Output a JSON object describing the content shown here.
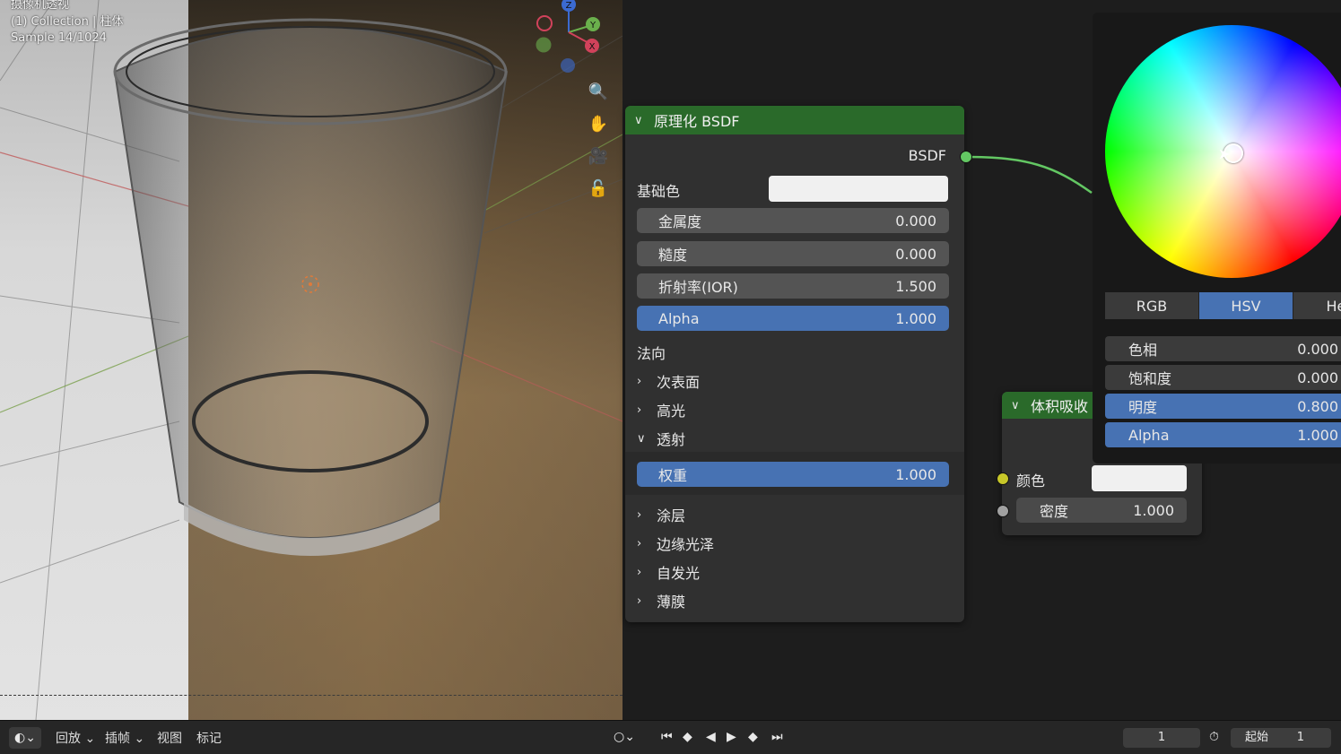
{
  "viewport": {
    "mode_label": "摄像机透视",
    "collection_label": "(1) Collection | 柱体",
    "sample_label": "Sample 14/1024",
    "gizmo_axes": {
      "z": "Z",
      "y": "Y",
      "x": "X"
    },
    "nav_icons": [
      "zoom-icon",
      "hand-icon",
      "camera-icon",
      "lock-icon"
    ]
  },
  "bsdf_node": {
    "title": "原理化 BSDF",
    "output_label": "BSDF",
    "base_color_label": "基础色",
    "fields": [
      {
        "label": "金属度",
        "value": "0.000"
      },
      {
        "label": "糙度",
        "value": "0.000"
      },
      {
        "label": "折射率(IOR)",
        "value": "1.500"
      },
      {
        "label": "Alpha",
        "value": "1.000"
      }
    ],
    "normal_label": "法向",
    "sections": [
      "次表面",
      "高光",
      "透射"
    ],
    "transmission_weight": {
      "label": "权重",
      "value": "1.000"
    },
    "sections_after": [
      "涂层",
      "边缘光泽",
      "自发光",
      "薄膜"
    ]
  },
  "volume_node": {
    "title": "体积吸收",
    "color_label": "颜色",
    "density_label": "密度",
    "density_value": "1.000"
  },
  "color_picker": {
    "tabs": [
      "RGB",
      "HSV",
      "Hex"
    ],
    "active_tab": "HSV",
    "fields": [
      {
        "label": "色相",
        "value": "0.000"
      },
      {
        "label": "饱和度",
        "value": "0.000"
      },
      {
        "label": "明度",
        "value": "0.800"
      },
      {
        "label": "Alpha",
        "value": "1.000"
      }
    ]
  },
  "timeline": {
    "playback_label": "回放",
    "keying_label": "插帧",
    "view_label": "视图",
    "marker_label": "标记",
    "current_frame": "1",
    "start_label": "起始",
    "start_value": "1"
  },
  "colors": {
    "accent_blue": "#4772b3",
    "node_header_green": "#2a6a2a",
    "socket_green": "#63c763",
    "socket_yellow": "#c7c729",
    "socket_gray": "#a1a1a1"
  }
}
